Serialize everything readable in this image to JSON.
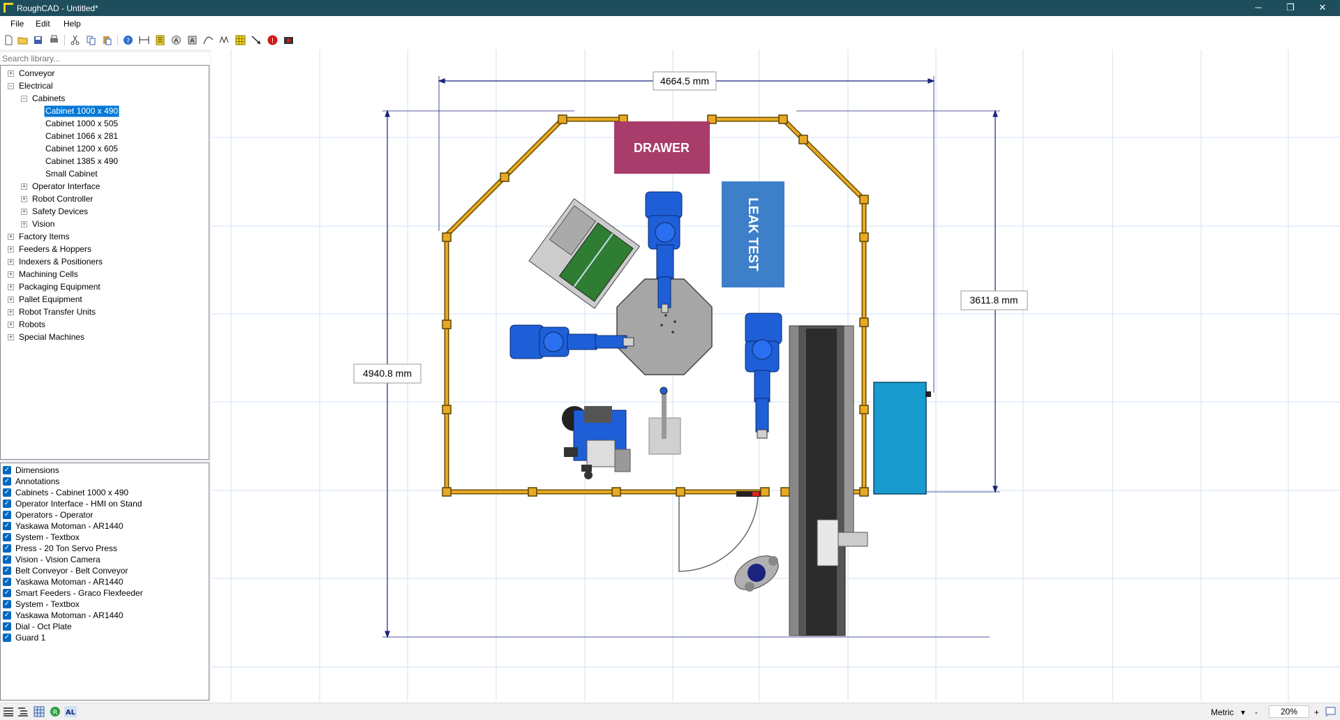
{
  "window": {
    "title": "RoughCAD - Untitled*",
    "minimize": "─",
    "restore": "❐",
    "close": "✕"
  },
  "menu": [
    "File",
    "Edit",
    "Help"
  ],
  "toolbar_icons": [
    "new-file-icon",
    "open-folder-icon",
    "save-icon",
    "print-icon",
    "cut-icon",
    "copy-icon",
    "paste-icon",
    "help-icon",
    "ruler-icon",
    "layer-icon",
    "circle-a-icon",
    "image-icon",
    "curve-icon",
    "wave-icon",
    "grid-icon",
    "arrow-icon",
    "error-icon",
    "camera-icon"
  ],
  "library": {
    "search_placeholder": "Search library...",
    "tree": [
      {
        "label": "Conveyor",
        "expander": "+"
      },
      {
        "label": "Electrical",
        "expander": "−"
      },
      {
        "label": "Cabinets",
        "expander": "−"
      },
      {
        "label": "Cabinet 1000 x 490",
        "selected": true
      },
      {
        "label": "Cabinet 1000 x 505"
      },
      {
        "label": "Cabinet 1066 x 281"
      },
      {
        "label": "Cabinet 1200 x 605"
      },
      {
        "label": "Cabinet 1385 x 490"
      },
      {
        "label": "Small Cabinet"
      },
      {
        "label": "Operator Interface",
        "expander": "+"
      },
      {
        "label": "Robot Controller",
        "expander": "+"
      },
      {
        "label": "Safety Devices",
        "expander": "+"
      },
      {
        "label": "Vision",
        "expander": "+"
      },
      {
        "label": "Factory Items",
        "expander": "+"
      },
      {
        "label": "Feeders & Hoppers",
        "expander": "+"
      },
      {
        "label": "Indexers & Positioners",
        "expander": "+"
      },
      {
        "label": "Machining Cells",
        "expander": "+"
      },
      {
        "label": "Packaging Equipment",
        "expander": "+"
      },
      {
        "label": "Pallet Equipment",
        "expander": "+"
      },
      {
        "label": "Robot Transfer Units",
        "expander": "+"
      },
      {
        "label": "Robots",
        "expander": "+"
      },
      {
        "label": "Special Machines",
        "expander": "+"
      }
    ]
  },
  "layers": [
    "Dimensions",
    "Annotations",
    "Cabinets - Cabinet 1000 x 490",
    "Operator Interface - HMI on Stand",
    "Operators - Operator",
    "Yaskawa Motoman - AR1440",
    "System - Textbox",
    "Press - 20 Ton Servo Press",
    "Vision - Vision Camera",
    "Belt Conveyor - Belt Conveyor",
    "Yaskawa Motoman - AR1440",
    "Smart Feeders - Graco Flexfeeder",
    "System - Textbox",
    "Yaskawa Motoman - AR1440",
    "Dial - Oct Plate",
    "Guard 1"
  ],
  "layer_check": "✓",
  "drawing": {
    "dimensions": [
      "4664.5 mm",
      "4940.8 mm",
      "3611.8 mm"
    ],
    "textboxes": [
      "DRAWER",
      "LEAK TEST"
    ],
    "colors": {
      "guard": "#e8a925",
      "robot": "#1e5fd8",
      "drawer": "#a83c6a",
      "leak_test": "#3d7fc9",
      "cabinet": "#1a9bd0",
      "grid": "#cfe0f5",
      "dimension": "#1a237e",
      "feeder": "#2e7d32"
    }
  },
  "status": {
    "units": "Metric",
    "units_arrow": "▾",
    "zoom_minus": "-",
    "zoom": "20%",
    "zoom_plus": "+",
    "icons": [
      "list-view-icon",
      "tree-view-icon",
      "grid-toggle-icon",
      "r-badge-icon",
      "al-icon"
    ]
  }
}
